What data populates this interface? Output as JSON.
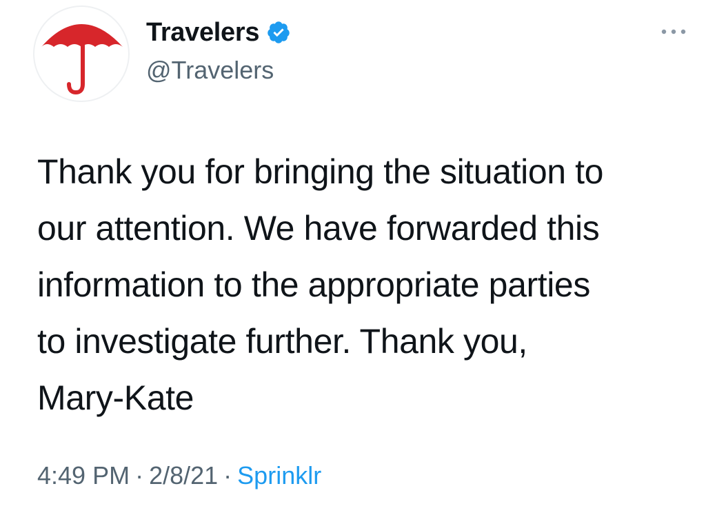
{
  "author": {
    "display_name": "Travelers",
    "handle": "@Travelers",
    "verified": true,
    "avatar_icon": "red-umbrella-logo-icon",
    "brand_color": "#d7262b"
  },
  "menu": {
    "icon": "more-options-icon"
  },
  "tweet": {
    "text": "Thank you for bringing the situation to\nour attention. We have forwarded this\ninformation to the appropriate parties\nto investigate further. Thank you,\nMary-Kate"
  },
  "meta": {
    "time": "4:49 PM",
    "separator": "·",
    "date": "2/8/21",
    "source": "Sprinklr",
    "source_color": "#1d9bf0"
  }
}
